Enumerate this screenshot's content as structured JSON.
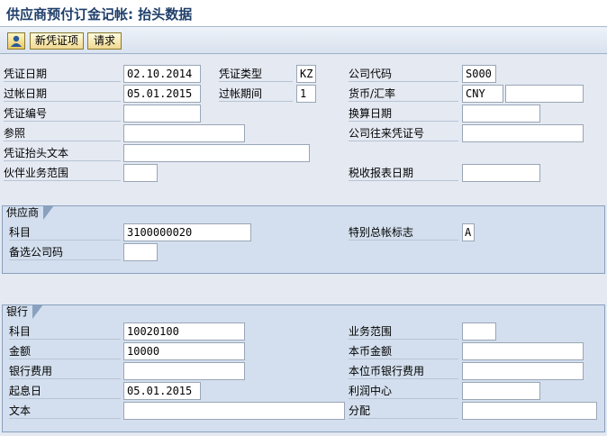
{
  "title": "供应商预付订金记帐: 抬头数据",
  "toolbar": {
    "new_voucher_item": "新凭证项",
    "request": "请求"
  },
  "header": {
    "doc_date": {
      "label": "凭证日期",
      "value": "02.10.2014"
    },
    "doc_type": {
      "label": "凭证类型",
      "value": "KZ"
    },
    "company_code": {
      "label": "公司代码",
      "value": "S000"
    },
    "posting_date": {
      "label": "过帐日期",
      "value": "05.01.2015"
    },
    "period": {
      "label": "过帐期间",
      "value": "1"
    },
    "currency": {
      "label": "货币/汇率",
      "value": "CNY",
      "rate": ""
    },
    "doc_number": {
      "label": "凭证编号",
      "value": ""
    },
    "translation_date": {
      "label": "换算日期",
      "value": ""
    },
    "reference": {
      "label": "参照",
      "value": ""
    },
    "intercompany_doc": {
      "label": "公司往来凭证号",
      "value": ""
    },
    "header_text": {
      "label": "凭证抬头文本",
      "value": ""
    },
    "partner_business_area": {
      "label": "伙伴业务范围",
      "value": ""
    },
    "tax_report_date": {
      "label": "税收报表日期",
      "value": ""
    }
  },
  "vendor": {
    "group_title": "供应商",
    "account": {
      "label": "科目",
      "value": "3100000020"
    },
    "special_gl": {
      "label": "特别总帐标志",
      "value": "A"
    },
    "alt_company_code": {
      "label": "备选公司码",
      "value": ""
    }
  },
  "bank": {
    "group_title": "银行",
    "account": {
      "label": "科目",
      "value": "10020100"
    },
    "business_area": {
      "label": "业务范围",
      "value": ""
    },
    "amount": {
      "label": "金额",
      "value": "10000"
    },
    "local_amount": {
      "label": "本币金额",
      "value": ""
    },
    "bank_charges": {
      "label": "银行费用",
      "value": ""
    },
    "local_bank_charges": {
      "label": "本位币银行费用",
      "value": ""
    },
    "value_date": {
      "label": "起息日",
      "value": "05.01.2015"
    },
    "profit_center": {
      "label": "利润中心",
      "value": ""
    },
    "text": {
      "label": "文本",
      "value": ""
    },
    "assignment": {
      "label": "分配",
      "value": ""
    }
  },
  "colors": {
    "title": "#1f3f6a",
    "group_bg": "#d3dfee",
    "body_bg": "#e4e9f2"
  },
  "icons": {
    "toolbar_icon": "person-icon"
  }
}
